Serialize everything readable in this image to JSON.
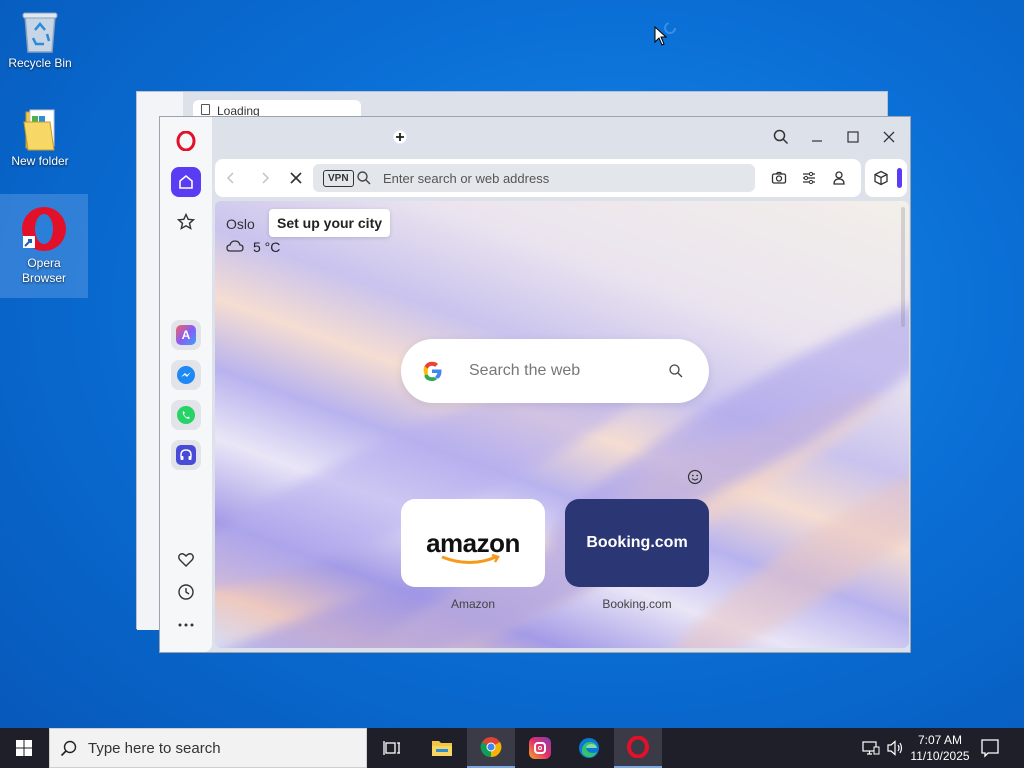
{
  "desktop": {
    "icons": [
      {
        "label": "Recycle Bin"
      },
      {
        "label": "New folder"
      },
      {
        "label": "Opera Browser"
      }
    ]
  },
  "back_window": {
    "tab_title": "Loading"
  },
  "browser": {
    "vpn_badge": "VPN",
    "address_placeholder": "Enter search or web address",
    "weather": {
      "city": "Oslo",
      "setup_tooltip": "Set up your city",
      "temperature": "5 °C"
    },
    "search": {
      "placeholder": "Search the web"
    },
    "speed_dials": [
      {
        "label": "Amazon",
        "logo_text": "amazon",
        "bg": "#ffffff"
      },
      {
        "label": "Booking.com",
        "logo_text": "Booking.com",
        "bg": "#2b3674"
      }
    ],
    "accent": "#5b3cf5",
    "opera_red": "#e3102a"
  },
  "taskbar": {
    "search_placeholder": "Type here to search",
    "time": "7:07 AM",
    "date": "11/10/2025",
    "apps": [
      "task-view",
      "file-explorer",
      "chrome",
      "instagram",
      "edge",
      "opera"
    ]
  }
}
